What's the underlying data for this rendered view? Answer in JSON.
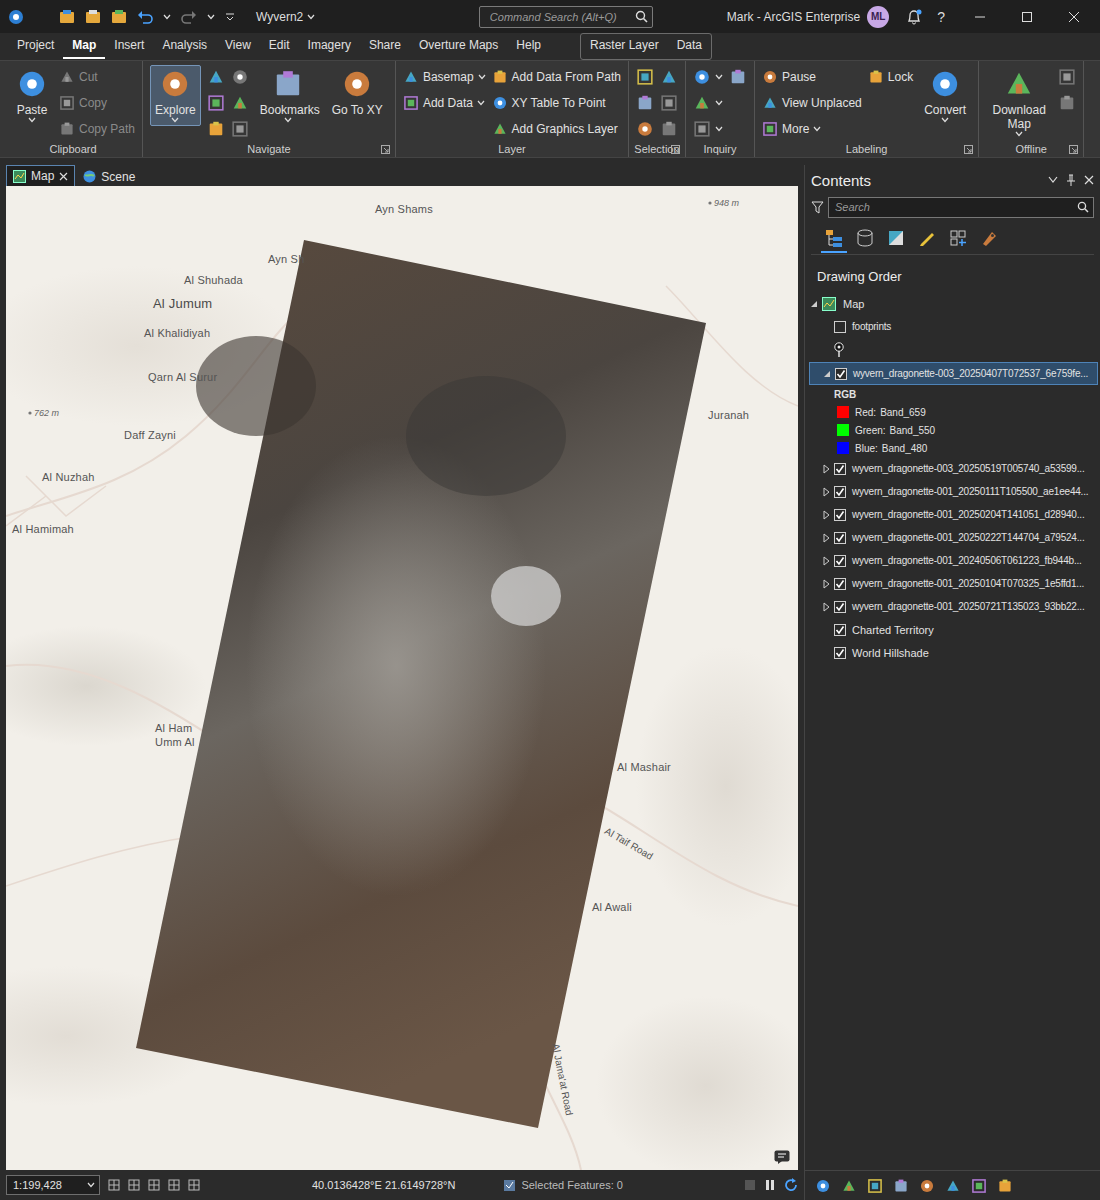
{
  "window": {
    "title": "Wyvern2",
    "search_placeholder": "Command Search (Alt+Q)",
    "user": "Mark - ArcGIS Enterprise",
    "avatar": "ML",
    "help": "?"
  },
  "ribbon_tabs": [
    {
      "label": "Project",
      "selected": false
    },
    {
      "label": "Map",
      "selected": true
    },
    {
      "label": "Insert",
      "selected": false
    },
    {
      "label": "Analysis",
      "selected": false
    },
    {
      "label": "View",
      "selected": false
    },
    {
      "label": "Edit",
      "selected": false
    },
    {
      "label": "Imagery",
      "selected": false
    },
    {
      "label": "Share",
      "selected": false
    },
    {
      "label": "Overture Maps",
      "selected": false
    },
    {
      "label": "Help",
      "selected": false
    }
  ],
  "context_tabs": [
    {
      "label": "Raster Layer",
      "selected": false
    },
    {
      "label": "Data",
      "selected": false
    }
  ],
  "ribbon_groups": [
    {
      "title": "Clipboard",
      "launcher": false,
      "columns": [
        [
          {
            "kind": "large",
            "label": "Paste",
            "dropdown": true,
            "disabled": false,
            "selected": false
          }
        ],
        [
          {
            "kind": "small",
            "label": "Cut",
            "dropdown": false,
            "disabled": true,
            "selected": false
          },
          {
            "kind": "small",
            "label": "Copy",
            "dropdown": false,
            "disabled": true,
            "selected": false
          },
          {
            "kind": "small",
            "label": "Copy Path",
            "dropdown": false,
            "disabled": true,
            "selected": false
          }
        ]
      ]
    },
    {
      "title": "Navigate",
      "launcher": true,
      "columns": [
        [
          {
            "kind": "large",
            "label": "Explore",
            "dropdown": true,
            "disabled": false,
            "selected": true
          }
        ],
        [
          {
            "kind": "icon",
            "dropdown": false,
            "disabled": false,
            "selected": false
          },
          {
            "kind": "icon",
            "dropdown": false,
            "disabled": false,
            "selected": false
          },
          {
            "kind": "icon",
            "dropdown": false,
            "disabled": false,
            "selected": false
          }
        ],
        [
          {
            "kind": "icon",
            "dropdown": false,
            "disabled": true,
            "selected": false
          },
          {
            "kind": "icon",
            "dropdown": false,
            "disabled": false,
            "selected": false
          },
          {
            "kind": "icon",
            "dropdown": false,
            "disabled": true,
            "selected": false
          }
        ],
        [
          {
            "kind": "large",
            "label": "Bookmarks",
            "dropdown": true,
            "disabled": false,
            "selected": false
          }
        ],
        [
          {
            "kind": "large",
            "label": "Go To XY",
            "dropdown": false,
            "disabled": false,
            "selected": false
          }
        ]
      ]
    },
    {
      "title": "Layer",
      "launcher": false,
      "columns": [
        [
          {
            "kind": "small",
            "label": "Basemap",
            "dropdown": true,
            "disabled": false,
            "selected": false
          },
          {
            "kind": "small",
            "label": "Add Data",
            "dropdown": true,
            "disabled": false,
            "selected": false
          }
        ],
        [
          {
            "kind": "small",
            "label": "Add Data From Path",
            "dropdown": false,
            "disabled": false,
            "selected": false
          },
          {
            "kind": "small",
            "label": "XY Table To Point",
            "dropdown": false,
            "disabled": false,
            "selected": false
          },
          {
            "kind": "small",
            "label": "Add Graphics Layer",
            "dropdown": false,
            "disabled": false,
            "selected": false
          }
        ]
      ]
    },
    {
      "title": "Selection",
      "launcher": true,
      "columns": [
        [
          {
            "kind": "icon",
            "dropdown": false,
            "disabled": false,
            "selected": false
          },
          {
            "kind": "icon",
            "dropdown": false,
            "disabled": false,
            "selected": false
          },
          {
            "kind": "icon",
            "dropdown": false,
            "disabled": false,
            "selected": false
          }
        ],
        [
          {
            "kind": "icon",
            "dropdown": false,
            "disabled": false,
            "selected": false
          },
          {
            "kind": "icon",
            "dropdown": false,
            "disabled": true,
            "selected": false
          },
          {
            "kind": "icon",
            "dropdown": false,
            "disabled": true,
            "selected": false
          }
        ]
      ]
    },
    {
      "title": "Inquiry",
      "launcher": false,
      "columns": [
        [
          {
            "kind": "icon",
            "dropdown": true,
            "disabled": false,
            "selected": false
          },
          {
            "kind": "icon",
            "dropdown": true,
            "disabled": false,
            "selected": false
          },
          {
            "kind": "icon",
            "dropdown": true,
            "disabled": true,
            "selected": false
          }
        ],
        [
          {
            "kind": "icon",
            "dropdown": false,
            "disabled": false,
            "selected": false
          }
        ]
      ]
    },
    {
      "title": "Labeling",
      "launcher": true,
      "columns": [
        [
          {
            "kind": "small",
            "label": "Pause",
            "dropdown": false,
            "disabled": false,
            "selected": false
          },
          {
            "kind": "small",
            "label": "View Unplaced",
            "dropdown": false,
            "disabled": false,
            "selected": false
          },
          {
            "kind": "small",
            "label": "More",
            "dropdown": true,
            "disabled": false,
            "selected": false
          }
        ],
        [
          {
            "kind": "small",
            "label": "Lock",
            "dropdown": false,
            "disabled": false,
            "selected": false
          }
        ],
        [
          {
            "kind": "large",
            "label": "Convert",
            "dropdown": true,
            "disabled": false,
            "selected": false
          }
        ]
      ]
    },
    {
      "title": "Offline",
      "launcher": true,
      "columns": [
        [
          {
            "kind": "large",
            "label": "Download Map",
            "dropdown": true,
            "disabled": false,
            "selected": false
          }
        ],
        [
          {
            "kind": "icon",
            "dropdown": false,
            "disabled": true,
            "selected": false
          },
          {
            "kind": "icon",
            "dropdown": false,
            "disabled": true,
            "selected": false
          }
        ]
      ]
    }
  ],
  "view_tabs": [
    {
      "label": "Map",
      "selected": true,
      "closable": true
    },
    {
      "label": "Scene",
      "selected": false,
      "closable": false
    }
  ],
  "map": {
    "places": [
      "Ayn Shams",
      "Ayn Sh",
      "Al Shuhada",
      "Al Jumum",
      "Al Khalidiyah",
      "Qarn Al Surur",
      "Juranah",
      "Daff Zayni",
      "Al Nuzhah",
      "Al Hamimah",
      "Al Ham",
      "Umm Al",
      "Al Mashair",
      "Al Awali"
    ],
    "spot_heights": [
      "948 m",
      "762 m"
    ],
    "roads": [
      "Al Taif Road",
      "Al Jama'at Road"
    ]
  },
  "status_bar": {
    "scale": "1:199,428",
    "coordinates": "40.0136428°E 21.6149728°N",
    "selected_features": "Selected Features: 0"
  },
  "contents": {
    "title": "Contents",
    "search_placeholder": "Search",
    "section_title": "Drawing Order",
    "tools": [
      {
        "selected": true
      },
      {
        "selected": false
      },
      {
        "selected": false
      },
      {
        "selected": false
      },
      {
        "selected": false
      },
      {
        "selected": false
      }
    ],
    "map_node": {
      "label": "Map",
      "expanded": true
    },
    "layers": [
      {
        "kind": "feature",
        "label": "footprints",
        "checked": false,
        "expanded": true,
        "selected": false
      },
      {
        "kind": "raster",
        "label": "wyvern_dragonette-003_20250407T072537_6e759fe...",
        "checked": true,
        "expanded": true,
        "selected": true,
        "legend": {
          "heading": "RGB",
          "entries": [
            {
              "label": "Red:",
              "value": "Band_659",
              "color": "#ff0000"
            },
            {
              "label": "Green:",
              "value": "Band_550",
              "color": "#00ff00"
            },
            {
              "label": "Blue:",
              "value": "Band_480",
              "color": "#0000ff"
            }
          ]
        }
      },
      {
        "kind": "raster",
        "label": "wyvern_dragonette-003_20250519T005740_a53599...",
        "checked": true,
        "expanded": false,
        "selected": false
      },
      {
        "kind": "raster",
        "label": "wyvern_dragonette-001_20250111T105500_ae1ee44...",
        "checked": true,
        "expanded": false,
        "selected": false
      },
      {
        "kind": "raster",
        "label": "wyvern_dragonette-001_20250204T141051_d28940...",
        "checked": true,
        "expanded": false,
        "selected": false
      },
      {
        "kind": "raster",
        "label": "wyvern_dragonette-001_20250222T144704_a79524...",
        "checked": true,
        "expanded": false,
        "selected": false
      },
      {
        "kind": "raster",
        "label": "wyvern_dragonette-001_20240506T061223_fb944b...",
        "checked": true,
        "expanded": false,
        "selected": false
      },
      {
        "kind": "raster",
        "label": "wyvern_dragonette-001_20250104T070325_1e5ffd1...",
        "checked": true,
        "expanded": false,
        "selected": false
      },
      {
        "kind": "raster",
        "label": "wyvern_dragonette-001_20250721T135023_93bb22...",
        "checked": true,
        "expanded": false,
        "selected": false
      },
      {
        "kind": "basemap",
        "label": "Charted Territory",
        "checked": true,
        "expanded": false,
        "selected": false
      },
      {
        "kind": "basemap",
        "label": "World Hillshade",
        "checked": true,
        "expanded": false,
        "selected": false
      }
    ]
  }
}
